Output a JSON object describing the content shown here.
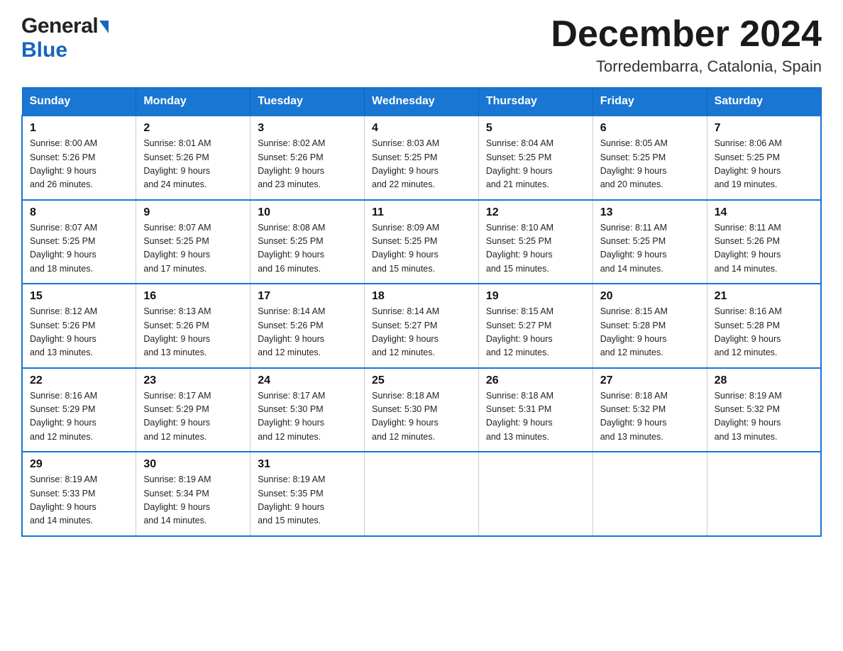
{
  "header": {
    "logo_general": "General",
    "logo_blue": "Blue",
    "month_title": "December 2024",
    "location": "Torredembarra, Catalonia, Spain"
  },
  "days_of_week": [
    "Sunday",
    "Monday",
    "Tuesday",
    "Wednesday",
    "Thursday",
    "Friday",
    "Saturday"
  ],
  "weeks": [
    [
      {
        "day": "1",
        "sunrise": "8:00 AM",
        "sunset": "5:26 PM",
        "daylight": "9 hours and 26 minutes."
      },
      {
        "day": "2",
        "sunrise": "8:01 AM",
        "sunset": "5:26 PM",
        "daylight": "9 hours and 24 minutes."
      },
      {
        "day": "3",
        "sunrise": "8:02 AM",
        "sunset": "5:26 PM",
        "daylight": "9 hours and 23 minutes."
      },
      {
        "day": "4",
        "sunrise": "8:03 AM",
        "sunset": "5:25 PM",
        "daylight": "9 hours and 22 minutes."
      },
      {
        "day": "5",
        "sunrise": "8:04 AM",
        "sunset": "5:25 PM",
        "daylight": "9 hours and 21 minutes."
      },
      {
        "day": "6",
        "sunrise": "8:05 AM",
        "sunset": "5:25 PM",
        "daylight": "9 hours and 20 minutes."
      },
      {
        "day": "7",
        "sunrise": "8:06 AM",
        "sunset": "5:25 PM",
        "daylight": "9 hours and 19 minutes."
      }
    ],
    [
      {
        "day": "8",
        "sunrise": "8:07 AM",
        "sunset": "5:25 PM",
        "daylight": "9 hours and 18 minutes."
      },
      {
        "day": "9",
        "sunrise": "8:07 AM",
        "sunset": "5:25 PM",
        "daylight": "9 hours and 17 minutes."
      },
      {
        "day": "10",
        "sunrise": "8:08 AM",
        "sunset": "5:25 PM",
        "daylight": "9 hours and 16 minutes."
      },
      {
        "day": "11",
        "sunrise": "8:09 AM",
        "sunset": "5:25 PM",
        "daylight": "9 hours and 15 minutes."
      },
      {
        "day": "12",
        "sunrise": "8:10 AM",
        "sunset": "5:25 PM",
        "daylight": "9 hours and 15 minutes."
      },
      {
        "day": "13",
        "sunrise": "8:11 AM",
        "sunset": "5:25 PM",
        "daylight": "9 hours and 14 minutes."
      },
      {
        "day": "14",
        "sunrise": "8:11 AM",
        "sunset": "5:26 PM",
        "daylight": "9 hours and 14 minutes."
      }
    ],
    [
      {
        "day": "15",
        "sunrise": "8:12 AM",
        "sunset": "5:26 PM",
        "daylight": "9 hours and 13 minutes."
      },
      {
        "day": "16",
        "sunrise": "8:13 AM",
        "sunset": "5:26 PM",
        "daylight": "9 hours and 13 minutes."
      },
      {
        "day": "17",
        "sunrise": "8:14 AM",
        "sunset": "5:26 PM",
        "daylight": "9 hours and 12 minutes."
      },
      {
        "day": "18",
        "sunrise": "8:14 AM",
        "sunset": "5:27 PM",
        "daylight": "9 hours and 12 minutes."
      },
      {
        "day": "19",
        "sunrise": "8:15 AM",
        "sunset": "5:27 PM",
        "daylight": "9 hours and 12 minutes."
      },
      {
        "day": "20",
        "sunrise": "8:15 AM",
        "sunset": "5:28 PM",
        "daylight": "9 hours and 12 minutes."
      },
      {
        "day": "21",
        "sunrise": "8:16 AM",
        "sunset": "5:28 PM",
        "daylight": "9 hours and 12 minutes."
      }
    ],
    [
      {
        "day": "22",
        "sunrise": "8:16 AM",
        "sunset": "5:29 PM",
        "daylight": "9 hours and 12 minutes."
      },
      {
        "day": "23",
        "sunrise": "8:17 AM",
        "sunset": "5:29 PM",
        "daylight": "9 hours and 12 minutes."
      },
      {
        "day": "24",
        "sunrise": "8:17 AM",
        "sunset": "5:30 PM",
        "daylight": "9 hours and 12 minutes."
      },
      {
        "day": "25",
        "sunrise": "8:18 AM",
        "sunset": "5:30 PM",
        "daylight": "9 hours and 12 minutes."
      },
      {
        "day": "26",
        "sunrise": "8:18 AM",
        "sunset": "5:31 PM",
        "daylight": "9 hours and 13 minutes."
      },
      {
        "day": "27",
        "sunrise": "8:18 AM",
        "sunset": "5:32 PM",
        "daylight": "9 hours and 13 minutes."
      },
      {
        "day": "28",
        "sunrise": "8:19 AM",
        "sunset": "5:32 PM",
        "daylight": "9 hours and 13 minutes."
      }
    ],
    [
      {
        "day": "29",
        "sunrise": "8:19 AM",
        "sunset": "5:33 PM",
        "daylight": "9 hours and 14 minutes."
      },
      {
        "day": "30",
        "sunrise": "8:19 AM",
        "sunset": "5:34 PM",
        "daylight": "9 hours and 14 minutes."
      },
      {
        "day": "31",
        "sunrise": "8:19 AM",
        "sunset": "5:35 PM",
        "daylight": "9 hours and 15 minutes."
      },
      null,
      null,
      null,
      null
    ]
  ],
  "labels": {
    "sunrise": "Sunrise:",
    "sunset": "Sunset:",
    "daylight": "Daylight:"
  }
}
